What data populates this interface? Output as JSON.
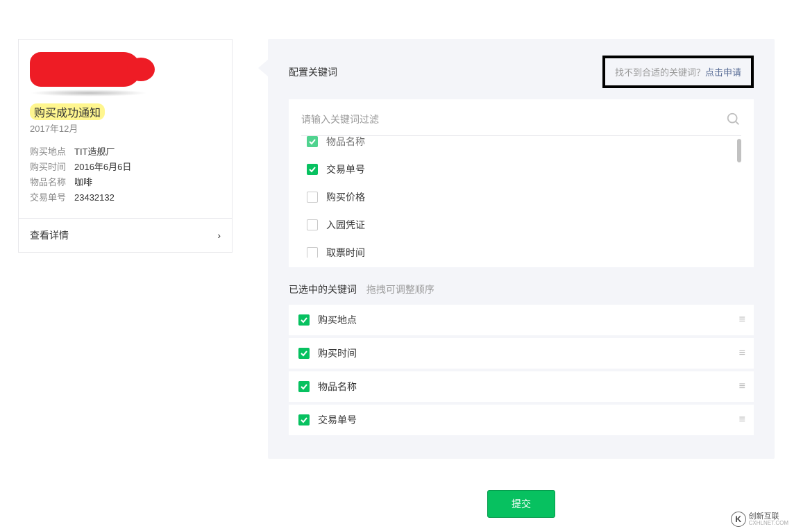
{
  "preview": {
    "notice_title": "购买成功通知",
    "notice_date": "2017年12月",
    "fields": [
      {
        "label": "购买地点",
        "value": "TIT造舰厂"
      },
      {
        "label": "购买时间",
        "value": "2016年6月6日"
      },
      {
        "label": "物品名称",
        "value": "咖啡"
      },
      {
        "label": "交易单号",
        "value": "23432132"
      }
    ],
    "footer_label": "查看详情"
  },
  "config": {
    "section_title": "配置关键词",
    "hint_prefix": "找不到合适的关键词？",
    "hint_link": "点击申请",
    "search_placeholder": "请输入关键词过滤",
    "keywords": [
      {
        "label": "物品名称",
        "checked": true,
        "cut": true
      },
      {
        "label": "交易单号",
        "checked": true
      },
      {
        "label": "购买价格",
        "checked": false
      },
      {
        "label": "入园凭证",
        "checked": false
      },
      {
        "label": "取票时间",
        "checked": false
      }
    ]
  },
  "selected": {
    "title": "已选中的关键词",
    "hint": "拖拽可调整顺序",
    "items": [
      {
        "label": "购买地点"
      },
      {
        "label": "购买时间"
      },
      {
        "label": "物品名称"
      },
      {
        "label": "交易单号"
      }
    ]
  },
  "submit_label": "提交",
  "brand": {
    "name": "创新互联",
    "sub": "CXHLNET.COM",
    "logo": "K"
  }
}
